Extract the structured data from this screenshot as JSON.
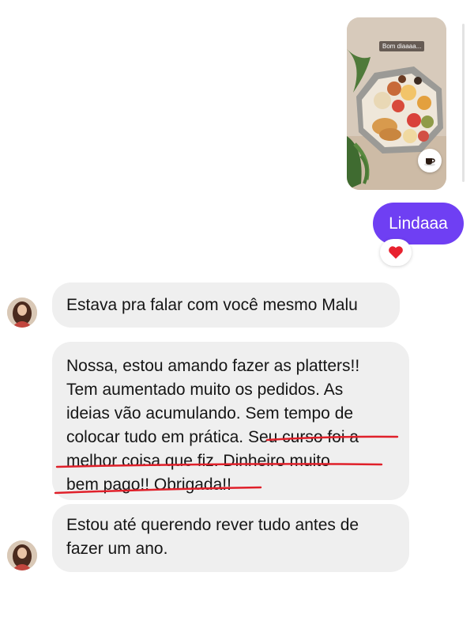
{
  "story": {
    "sticker_text": "Bom diaaaa...",
    "icon": "coffee-cup-icon"
  },
  "outgoing": {
    "text": "Lindaaa",
    "reaction_icon": "heart-icon"
  },
  "incoming": [
    {
      "lines": [
        "Estava pra falar com você mesmo Malu"
      ]
    },
    {
      "lines": [
        "Nossa, estou amando fazer as platters!!",
        "Tem aumentado muito os pedidos. As",
        "ideias vão acumulando. Sem tempo de",
        "colocar tudo em prática. Seu curso foi a",
        "melhor coisa que fiz. Dinheiro muito",
        "bem pago!! Obrigada!!"
      ]
    },
    {
      "lines": [
        "Estou até querendo rever tudo antes de",
        "fazer um ano."
      ]
    }
  ],
  "colors": {
    "outgoing_bubble": "#6f3ff3",
    "incoming_bubble": "#efefef",
    "underline": "#e0202a",
    "heart": "#e8212e"
  }
}
